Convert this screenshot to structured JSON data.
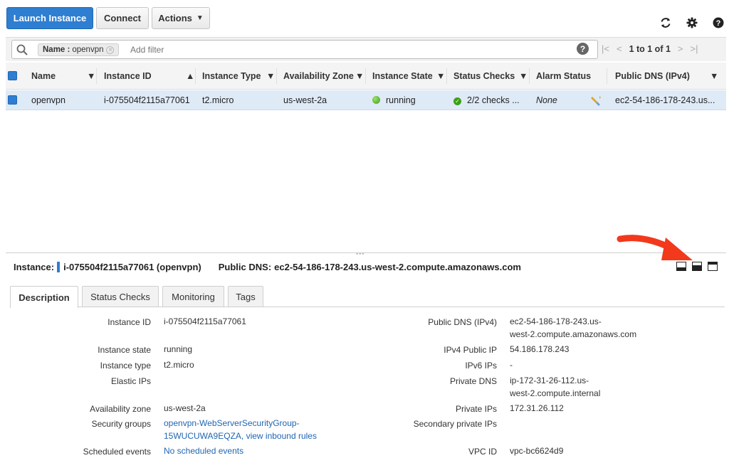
{
  "toolbar": {
    "launch_label": "Launch Instance",
    "connect_label": "Connect",
    "actions_label": "Actions",
    "refresh_icon": "refresh-icon",
    "settings_icon": "gear-icon",
    "help_icon": "help-icon"
  },
  "filter": {
    "chip_key": "Name :",
    "chip_value": "openvpn",
    "placeholder": "Add filter",
    "help_symbol": "?"
  },
  "pager": {
    "first": "|<",
    "prev": "<",
    "count": "1 to 1 of 1",
    "next": ">",
    "last": ">|"
  },
  "table": {
    "columns": [
      "Name",
      "Instance ID",
      "Instance Type",
      "Availability Zone",
      "Instance State",
      "Status Checks",
      "Alarm Status",
      "Public DNS (IPv4)"
    ],
    "rows": [
      {
        "name": "openvpn",
        "instance_id": "i-075504f2115a77061",
        "instance_type": "t2.micro",
        "availability_zone": "us-west-2a",
        "instance_state": "running",
        "status_checks": "2/2 checks ...",
        "alarm_status": "None",
        "public_dns": "ec2-54-186-178-243.us..."
      }
    ]
  },
  "detail_header": {
    "instance_label": "Instance:",
    "instance_value": "i-075504f2115a77061 (openvpn)",
    "dns_label": "Public DNS:",
    "dns_value": "ec2-54-186-178-243.us-west-2.compute.amazonaws.com"
  },
  "tabs": [
    "Description",
    "Status Checks",
    "Monitoring",
    "Tags"
  ],
  "description": {
    "left": [
      {
        "label": "Instance ID",
        "value": "i-075504f2115a77061"
      },
      {
        "label": "Instance state",
        "value": "running"
      },
      {
        "label": "Instance type",
        "value": "t2.micro"
      },
      {
        "label": "Elastic IPs",
        "value": ""
      },
      {
        "label": "Availability zone",
        "value": "us-west-2a"
      },
      {
        "label": "Security groups",
        "value_line1": "openvpn-WebServerSecurityGroup-",
        "value_line2": "15WUCUWA9EQZA",
        "value_link2": "view inbound rules"
      },
      {
        "label": "Scheduled events",
        "value": "No scheduled events"
      }
    ],
    "right": [
      {
        "label": "Public DNS (IPv4)",
        "value_line1": "ec2-54-186-178-243.us-",
        "value_line2": "west-2.compute.amazonaws.com"
      },
      {
        "label": "IPv4 Public IP",
        "value": "54.186.178.243"
      },
      {
        "label": "IPv6 IPs",
        "value": "-"
      },
      {
        "label": "Private DNS",
        "value_line1": "ip-172-31-26-112.us-",
        "value_line2": "west-2.compute.internal"
      },
      {
        "label": "Private IPs",
        "value": "172.31.26.112"
      },
      {
        "label": "Secondary private IPs",
        "value": ""
      },
      {
        "label": "VPC ID",
        "value": "vpc-bc6624d9"
      }
    ]
  },
  "colors": {
    "primary": "#2e7ed1",
    "selected_row": "#dfeaf7",
    "link": "#1f66b3",
    "arrow": "#f2391c",
    "running": "#3ca016"
  }
}
